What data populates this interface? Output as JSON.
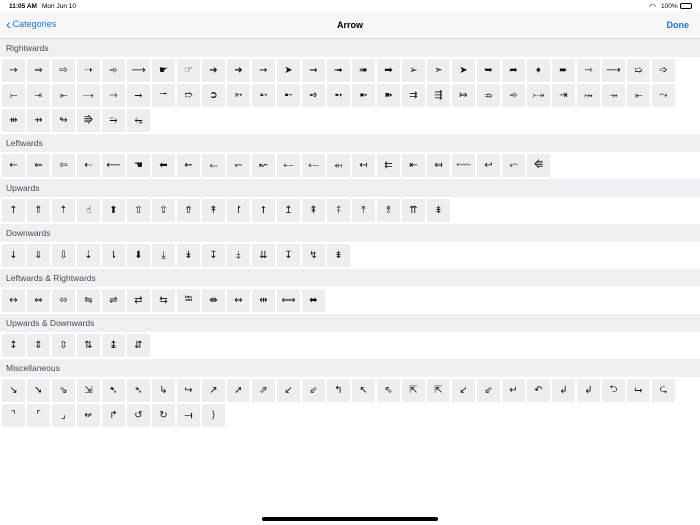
{
  "status": {
    "time": "11:05 AM",
    "date": "Mon Jun 10",
    "battery": "100%"
  },
  "nav": {
    "back_label": "Categories",
    "title": "Arrow",
    "done_label": "Done"
  },
  "sections": [
    {
      "name": "Rightwards",
      "symbols": [
        "→",
        "⇒",
        "⇨",
        "➝",
        "➾",
        "⟶",
        "☛",
        "☞",
        "➔",
        "➜",
        "➙",
        "➤",
        "➞",
        "➟",
        "➠",
        "➡",
        "➢",
        "➣",
        "➤",
        "➥",
        "➦",
        "➧",
        "➨",
        "⇾",
        "⟶",
        "➯",
        "➩",
        "⤚",
        "⤛",
        "⤜",
        "⤏",
        "⤑",
        "⭢",
        "⭬",
        "➱",
        "➲",
        "➳",
        "➵",
        "➸",
        "➺",
        "➻",
        "➼",
        "➽",
        "⇉",
        "⇶",
        "⤇",
        "⤃",
        "➾",
        "⤐",
        "⇥",
        "⤠",
        "⤞",
        "⤜",
        "⤳",
        "⇻",
        "⇸",
        "↬",
        "⭆",
        "⭇",
        "⭊"
      ]
    },
    {
      "name": "Leftwards",
      "symbols": [
        "←",
        "⇐",
        "⇦",
        "⇠",
        "⟵",
        "☚",
        "⬅",
        "⇜",
        "⬸",
        "↽",
        "↜",
        "⤌",
        "⤎",
        "⬶",
        "↤",
        "⇇",
        "⇤",
        "⤆",
        "⬳",
        "↩",
        "⬿",
        "⭅"
      ]
    },
    {
      "name": "Upwards",
      "symbols": [
        "↑",
        "⇑",
        "⇡",
        "☝",
        "⬆",
        "⇧",
        "⇪",
        "⇮",
        "↟",
        "↾",
        "⭡",
        "↥",
        "⇞",
        "⤉",
        "⤒",
        "⥉",
        "⇈",
        "⇟"
      ]
    },
    {
      "name": "Downwards",
      "symbols": [
        "↓",
        "⇓",
        "⇩",
        "⇣",
        "⇂",
        "⬇",
        "⤓",
        "↡",
        "↧",
        "⤈",
        "⇊",
        "↧",
        "↯",
        "⇟"
      ]
    },
    {
      "name": "Leftwards & Rightwards",
      "symbols": [
        "↔",
        "⇔",
        "⬄",
        "⇋",
        "⇌",
        "⇄",
        "⇆",
        "⭾",
        "⇼",
        "↭",
        "⇹",
        "⟺",
        "⬌"
      ]
    },
    {
      "name": "Upwards & Downwards",
      "symbols": [
        "↕",
        "⇕",
        "⇳",
        "⇅",
        "↨",
        "⇵"
      ]
    },
    {
      "name": "Miscellaneous",
      "symbols": [
        "↘",
        "➘",
        "⇘",
        "⇲",
        "➷",
        "➴",
        "↳",
        "↪",
        "↗",
        "➚",
        "⇗",
        "↙",
        "⇙",
        "↰",
        "↖",
        "⇖",
        "⇱",
        "⇱",
        "↙",
        "⇙",
        "↵",
        "↶",
        "↲",
        "↲",
        "⮌",
        "⮡",
        "⮎",
        "⌝",
        "⌜",
        "⌟",
        "↚",
        "↱",
        "↺",
        "↻",
        "⟞",
        "⟩"
      ]
    }
  ]
}
